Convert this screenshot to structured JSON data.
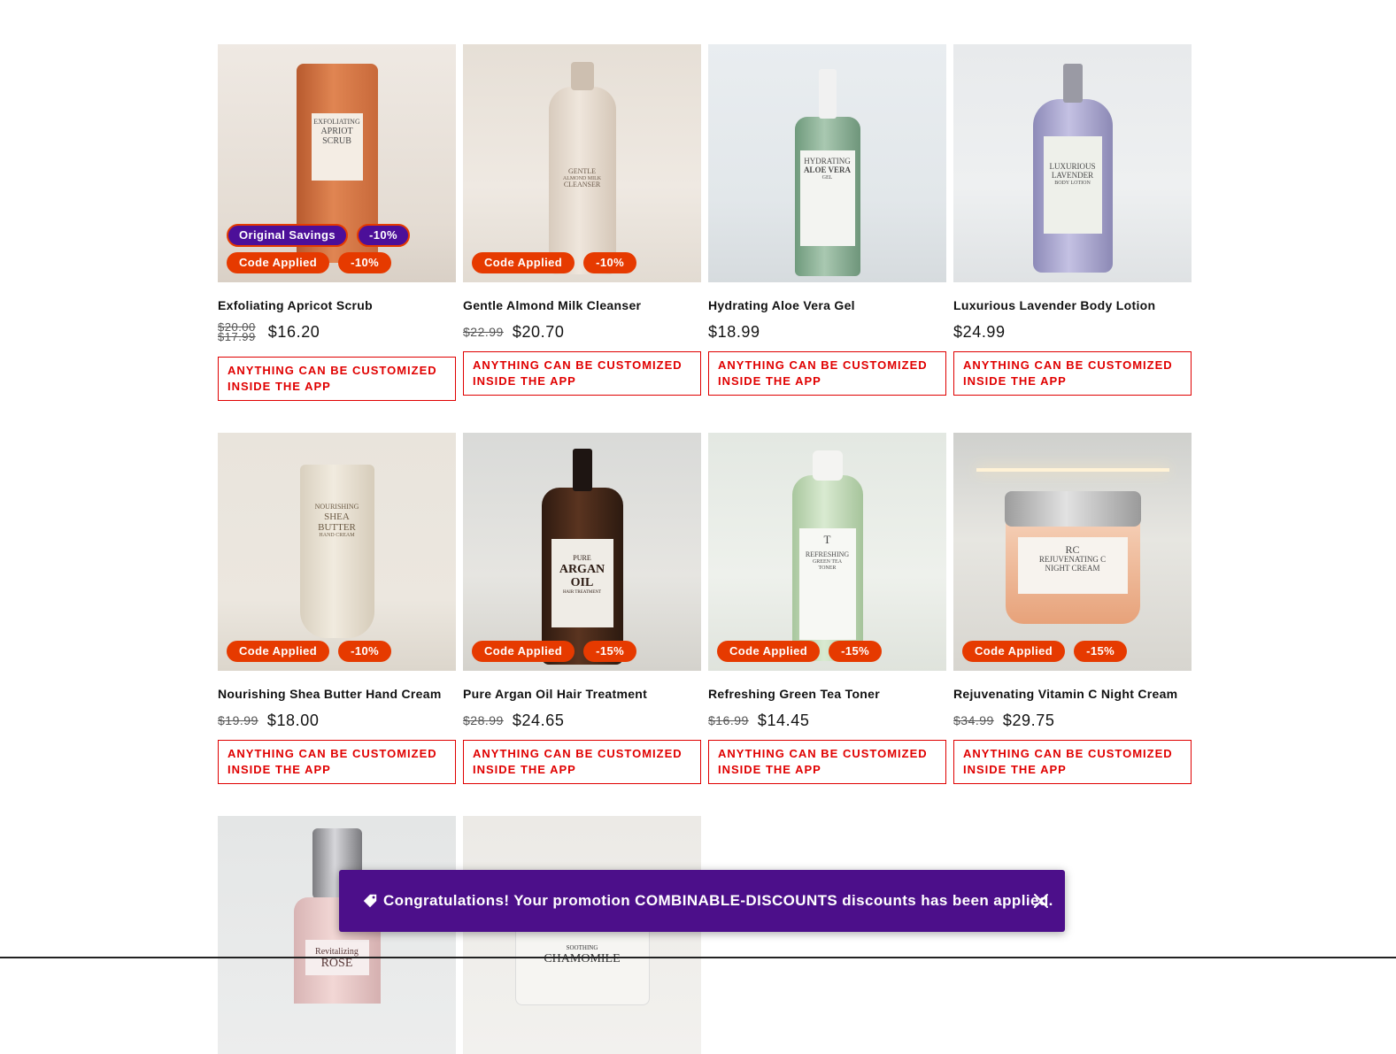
{
  "products": [
    {
      "title": "Exfoliating Apricot Scrub",
      "label_lines": [
        "EXFOLIATING",
        "APRIOT",
        "SCRUB"
      ],
      "old_prices": [
        "$20.00",
        "$17.99"
      ],
      "price": "$16.20",
      "badges": [
        [
          "Original Savings",
          "-10%"
        ],
        [
          "Code Applied",
          "-10%"
        ]
      ],
      "cta": "Anything can be customized inside the app"
    },
    {
      "title": "Gentle Almond Milk Cleanser",
      "label_lines": [
        "GENTLE",
        "ALMOND MILK",
        "CLEANSER"
      ],
      "old_prices": [
        "$22.99"
      ],
      "price": "$20.70",
      "badges": [
        [
          "Code Applied",
          "-10%"
        ]
      ],
      "cta": "Anything can be customized inside the app"
    },
    {
      "title": "Hydrating Aloe Vera Gel",
      "label_lines": [
        "HYDRATING",
        "ALOE VERA",
        "GEL"
      ],
      "old_prices": [],
      "price": "$18.99",
      "badges": [],
      "cta": "Anything can be customized inside the app"
    },
    {
      "title": "Luxurious Lavender Body Lotion",
      "label_lines": [
        "LUXURIOUS",
        "LAVENDER",
        "BODY LOTION"
      ],
      "old_prices": [],
      "price": "$24.99",
      "badges": [],
      "cta": "Anything can be customized inside the app"
    },
    {
      "title": "Nourishing Shea Butter Hand Cream",
      "label_lines": [
        "NOURISHING",
        "SHEA",
        "BUTTER",
        "HAND CREAM"
      ],
      "old_prices": [
        "$19.99"
      ],
      "price": "$18.00",
      "badges": [
        [
          "Code Applied",
          "-10%"
        ]
      ],
      "cta": "Anything can be customized inside the app"
    },
    {
      "title": "Pure Argan Oil Hair Treatment",
      "label_lines": [
        "PURE",
        "ARGAN",
        "OIL",
        "HAIR TREATMENT"
      ],
      "old_prices": [
        "$28.99"
      ],
      "price": "$24.65",
      "badges": [
        [
          "Code Applied",
          "-15%"
        ]
      ],
      "cta": "Anything can be customized inside the app"
    },
    {
      "title": "Refreshing Green Tea Toner",
      "label_lines": [
        "T",
        "REFRESHING",
        "GREEN TEA",
        "TONER"
      ],
      "old_prices": [
        "$16.99"
      ],
      "price": "$14.45",
      "badges": [
        [
          "Code Applied",
          "-15%"
        ]
      ],
      "cta": "Anything can be customized inside the app"
    },
    {
      "title": "Rejuvenating Vitamin C Night Cream",
      "label_lines": [
        "RC",
        "REJUVENATING C",
        "NIGHT CREAM"
      ],
      "old_prices": [
        "$34.99"
      ],
      "price": "$29.75",
      "badges": [
        [
          "Code Applied",
          "-15%"
        ]
      ],
      "cta": "Anything can be customized inside the app"
    },
    {
      "title": "",
      "label_lines": [
        "Revitalizing",
        "ROSE"
      ],
      "old_prices": [],
      "price": "",
      "badges": [],
      "cta": ""
    },
    {
      "title": "",
      "label_lines": [
        "SOOTHING",
        "CHAMOMILE"
      ],
      "old_prices": [],
      "price": "",
      "badges": [],
      "cta": ""
    }
  ],
  "toast": {
    "icon": "tag-icon",
    "message": "Congratulations! Your promotion COMBINABLE-DISCOUNTS discounts has been applied.",
    "close_icon": "close-icon"
  },
  "colors": {
    "badge_red": "#e63a00",
    "badge_purple": "#4c0f99",
    "toast_bg": "#4c0f8a",
    "cta_red": "#e00000"
  }
}
